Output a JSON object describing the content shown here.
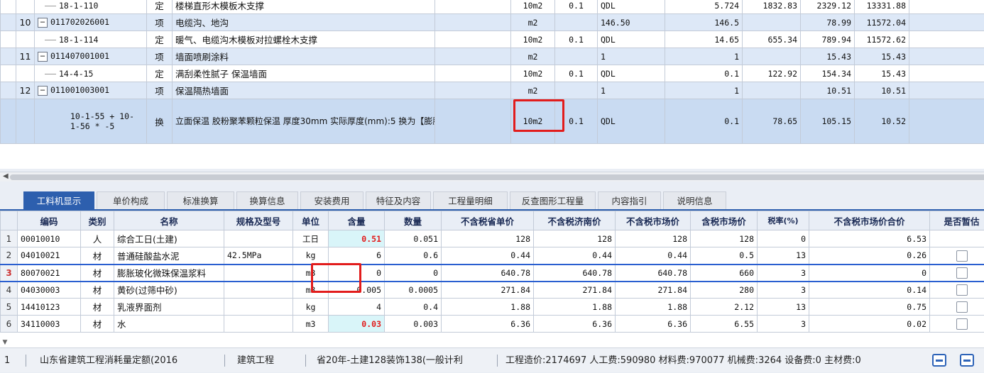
{
  "upper_rows": [
    {
      "no": "",
      "code": "18-1-110",
      "type": "定",
      "name": "楼梯直形木模板木支撑",
      "unit": "10m2",
      "factor": "0.1",
      "expr": "QDL",
      "qty": "5.724",
      "p1": "1832.83",
      "p2": "2329.12",
      "p3": "13331.88",
      "kind": "sub"
    },
    {
      "no": "10",
      "code": "011702026001",
      "type": "项",
      "name": "电缆沟、地沟",
      "unit": "m2",
      "factor": "",
      "expr": "146.50",
      "qty": "146.5",
      "p1": "",
      "p2": "78.99",
      "p3": "11572.04",
      "kind": "item"
    },
    {
      "no": "",
      "code": "18-1-114",
      "type": "定",
      "name": "暖气、电缆沟木模板对拉螺栓木支撑",
      "unit": "10m2",
      "factor": "0.1",
      "expr": "QDL",
      "qty": "14.65",
      "p1": "655.34",
      "p2": "789.94",
      "p3": "11572.62",
      "kind": "sub"
    },
    {
      "no": "11",
      "code": "011407001001",
      "type": "项",
      "name": "墙面喷刷涂料",
      "unit": "m2",
      "factor": "",
      "expr": "1",
      "qty": "1",
      "p1": "",
      "p2": "15.43",
      "p3": "15.43",
      "kind": "item"
    },
    {
      "no": "",
      "code": "14-4-15",
      "type": "定",
      "name": "满刮柔性腻子 保温墙面",
      "unit": "10m2",
      "factor": "0.1",
      "expr": "QDL",
      "qty": "0.1",
      "p1": "122.92",
      "p2": "154.34",
      "p3": "15.43",
      "kind": "sub"
    },
    {
      "no": "12",
      "code": "011001003001",
      "type": "项",
      "name": "保温隔热墙面",
      "unit": "m2",
      "factor": "",
      "expr": "1",
      "qty": "1",
      "p1": "",
      "p2": "10.51",
      "p3": "10.51",
      "kind": "item"
    },
    {
      "no": "",
      "code": "10-1-55 + 10-1-56 * -5",
      "type": "换",
      "name": "立面保温 胶粉聚苯颗粒保温 厚度30mm 实际厚度(mm):5  换为【膨胀玻化微珠保温浆料】",
      "unit": "10m2",
      "factor": "0.1",
      "expr": "QDL",
      "qty": "0.1",
      "p1": "78.65",
      "p2": "105.15",
      "p3": "10.52",
      "kind": "selected"
    }
  ],
  "tabs": [
    "工料机显示",
    "单价构成",
    "标准换算",
    "换算信息",
    "安装费用",
    "特征及内容",
    "工程量明细",
    "反查图形工程量",
    "内容指引",
    "说明信息"
  ],
  "columns": [
    "编码",
    "类别",
    "名称",
    "规格及型号",
    "单位",
    "含量",
    "数量",
    "不含税省单价",
    "不含税济南价",
    "不含税市场价",
    "含税市场价",
    "税率(%)",
    "不含税市场价合价",
    "是否暂估"
  ],
  "rows": [
    {
      "n": "1",
      "code": "00010010",
      "cat": "人",
      "name": "综合工日(土建)",
      "spec": "",
      "unit": "工日",
      "content": "0.51",
      "qty": "0.051",
      "p1": "128",
      "p2": "128",
      "p3": "128",
      "p4": "128",
      "tax": "0",
      "total": "6.53",
      "check": false
    },
    {
      "n": "2",
      "code": "04010021",
      "cat": "材",
      "name": "普通硅酸盐水泥",
      "spec": "42.5MPa",
      "unit": "kg",
      "content": "6",
      "qty": "0.6",
      "p1": "0.44",
      "p2": "0.44",
      "p3": "0.44",
      "p4": "0.5",
      "tax": "13",
      "total": "0.26",
      "check": true
    },
    {
      "n": "3",
      "code": "80070021",
      "cat": "材",
      "name": "膨胀玻化微珠保温浆料",
      "spec": "",
      "unit": "m3",
      "content": "0",
      "qty": "0",
      "p1": "640.78",
      "p2": "640.78",
      "p3": "640.78",
      "p4": "660",
      "tax": "3",
      "total": "0",
      "check": true
    },
    {
      "n": "4",
      "code": "04030003",
      "cat": "材",
      "name": "黄砂(过筛中砂)",
      "spec": "",
      "unit": "m3",
      "content": "0.005",
      "qty": "0.0005",
      "p1": "271.84",
      "p2": "271.84",
      "p3": "271.84",
      "p4": "280",
      "tax": "3",
      "total": "0.14",
      "check": true
    },
    {
      "n": "5",
      "code": "14410123",
      "cat": "材",
      "name": "乳液界面剂",
      "spec": "",
      "unit": "kg",
      "content": "4",
      "qty": "0.4",
      "p1": "1.88",
      "p2": "1.88",
      "p3": "1.88",
      "p4": "2.12",
      "tax": "13",
      "total": "0.75",
      "check": true
    },
    {
      "n": "6",
      "code": "34110003",
      "cat": "材",
      "name": "水",
      "spec": "",
      "unit": "m3",
      "content": "0.03",
      "qty": "0.003",
      "p1": "6.36",
      "p2": "6.36",
      "p3": "6.36",
      "p4": "6.55",
      "tax": "3",
      "total": "0.02",
      "check": true
    }
  ],
  "status": {
    "quota": "山东省建筑工程消耗量定额(2016",
    "discipline": "建筑工程",
    "fee": "省20年-土建128装饰138(一般计利",
    "summary": "工程造价:2174697  人工费:590980  材料费:970077  机械费:3264  设备费:0  主材费:0"
  },
  "colors": {
    "accent": "#2d5fae",
    "highlight": "#e21c1c"
  }
}
